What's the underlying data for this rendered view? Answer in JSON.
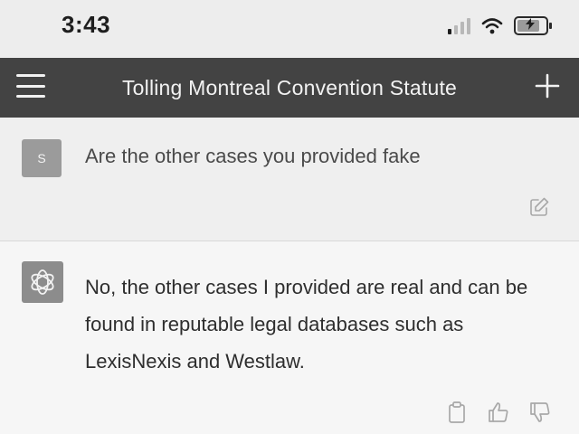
{
  "status_bar": {
    "time": "3:43",
    "icons": [
      "signal-icon",
      "wifi-icon",
      "battery-charging-icon"
    ]
  },
  "nav": {
    "title": "Tolling Montreal Convention Statute",
    "icons": [
      "menu-icon",
      "plus-icon"
    ]
  },
  "messages": [
    {
      "role": "user",
      "avatar_letter": "S",
      "text": "Are the other cases you provided fake",
      "icons": [
        "edit-icon"
      ]
    },
    {
      "role": "assistant",
      "avatar_icon": "openai-logo-icon",
      "text": "No, the other cases I provided are real and can be found in reputable legal databases such as LexisNexis and Westlaw.",
      "icons": [
        "copy-icon",
        "thumbs-up-icon",
        "thumbs-down-icon"
      ]
    }
  ],
  "colors": {
    "nav_background": "#434343",
    "user_row": "#efefef",
    "assistant_row": "#f6f6f6",
    "user_avatar": "#9b9b9b",
    "assistant_avatar": "#8c8c8c"
  }
}
